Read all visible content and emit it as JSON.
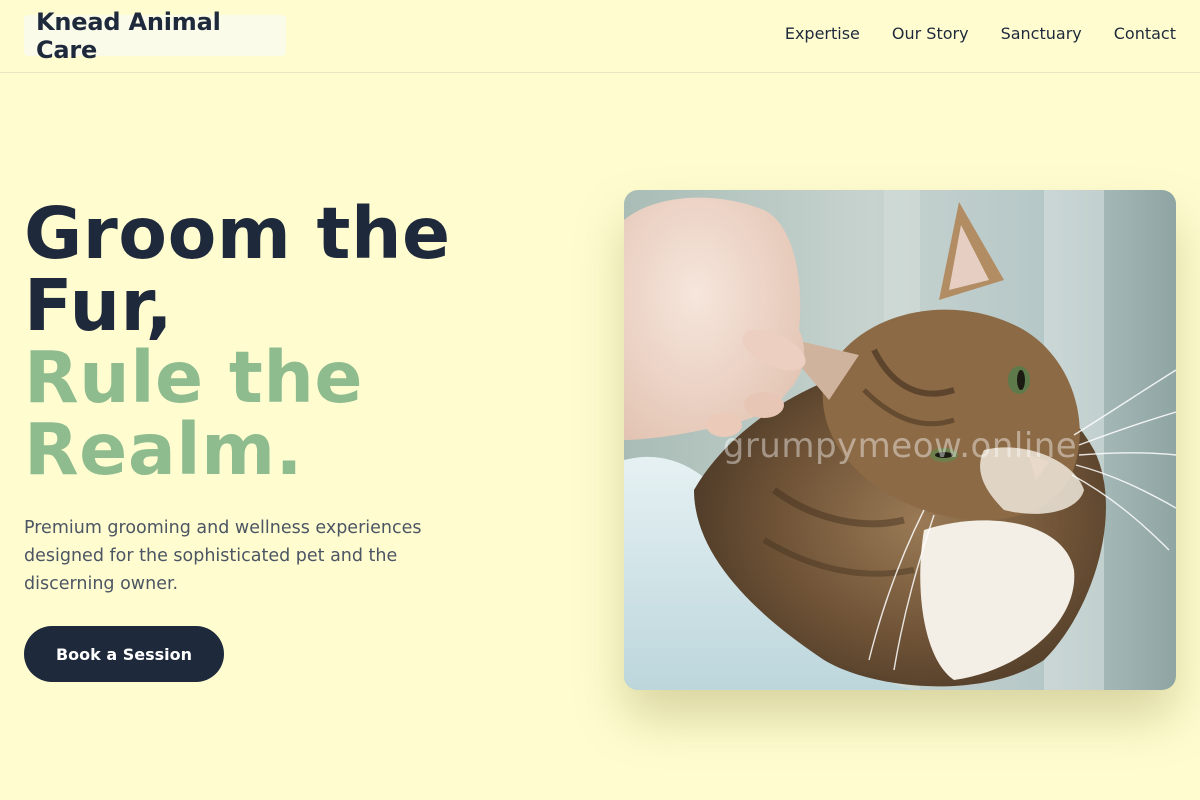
{
  "brand": {
    "name": "Knead Animal Care"
  },
  "nav": {
    "items": [
      {
        "label": "Expertise"
      },
      {
        "label": "Our Story"
      },
      {
        "label": "Sanctuary"
      },
      {
        "label": "Contact"
      }
    ]
  },
  "hero": {
    "headline_line1": "Groom the",
    "headline_line2": "Fur,",
    "headline_accent_line1": "Rule the",
    "headline_accent_line2": "Realm.",
    "subtitle": "Premium grooming and wellness experiences designed for the sophisticated pet and the discerning owner.",
    "cta_label": "Book a Session",
    "image_watermark": "grumpymeow.online"
  },
  "colors": {
    "background": "#fffdd0",
    "text_dark": "#1e293b",
    "accent_green": "#8fbc8f",
    "body_text": "#4b5563",
    "button_bg": "#1e293b"
  }
}
